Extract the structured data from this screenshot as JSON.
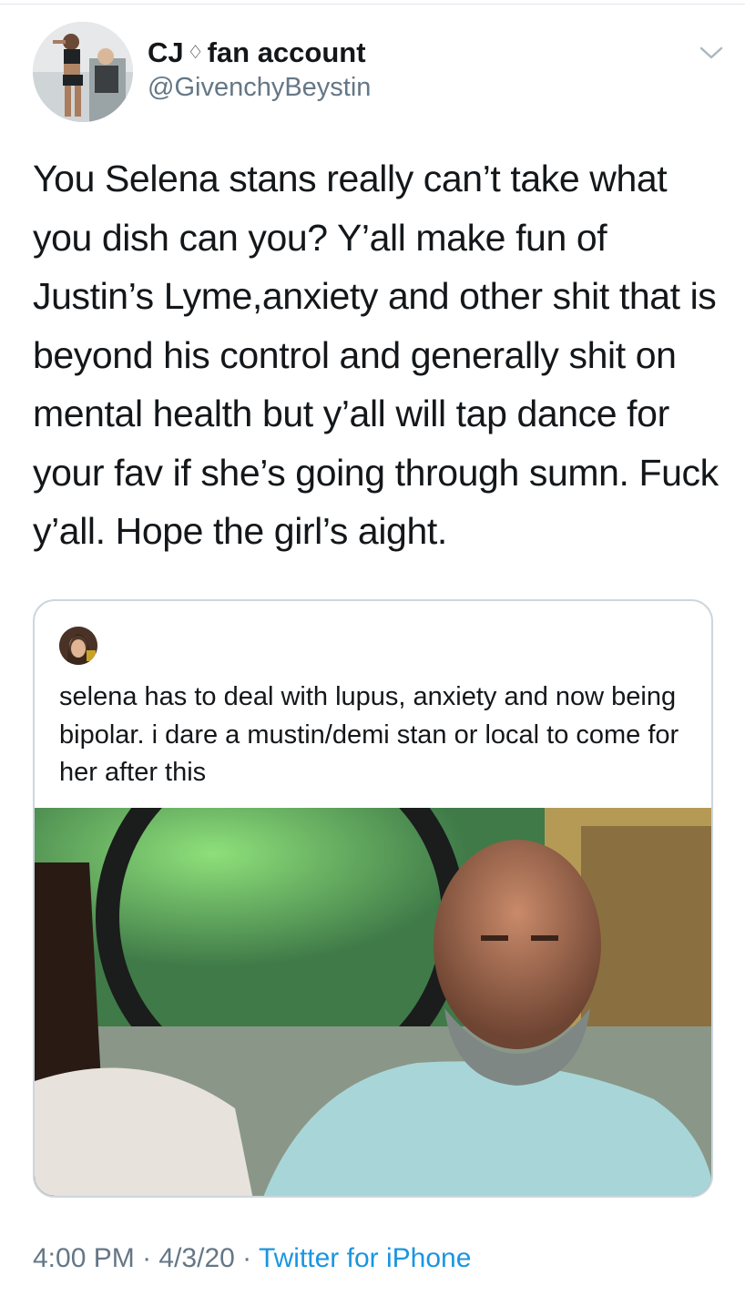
{
  "tweet": {
    "author": {
      "display_name_before": "CJ",
      "display_name_badge": "♢",
      "display_name_after": "fan account",
      "handle": "@GivenchyBeystin",
      "avatar_icon": "profile-photo"
    },
    "more_icon": "chevron-down-icon",
    "text": "You Selena stans really can’t take what you dish can you? Y’all make fun of Justin’s Lyme,anxiety and other shit that is beyond his control and generally shit on mental health but y’all will tap dance for your fav if she’s going through sumn. Fuck y’all. Hope the girl’s aight.",
    "quoted": {
      "avatar_icon": "profile-photo",
      "text": "selena has to deal with lupus, anxiety and now being bipolar. i dare a mustin/demi stan or local to come for her after this",
      "media_icon": "reaction-gif-image"
    },
    "meta": {
      "time": "4:00 PM",
      "sep1": " · ",
      "date": "4/3/20",
      "sep2": " · ",
      "source": "Twitter for iPhone"
    }
  },
  "colors": {
    "primary_text": "#14171a",
    "secondary_text": "#657786",
    "link": "#1b95e0",
    "border": "#ccd6dd"
  }
}
